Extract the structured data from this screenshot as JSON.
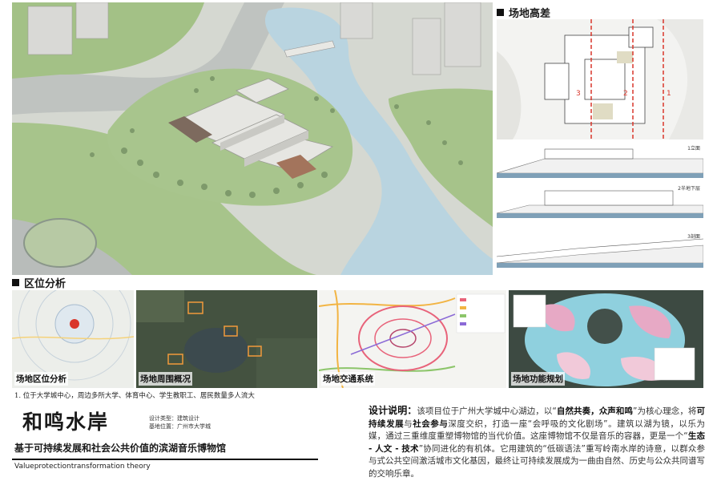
{
  "sections": {
    "elevation_title": "场地高差",
    "location_title": "区位分析"
  },
  "site_plan": {
    "line_labels": [
      "3",
      "2",
      "1"
    ]
  },
  "section_tags": [
    "1立面",
    "2半地下层",
    "3剖面"
  ],
  "panels": [
    {
      "label": "场地区位分析"
    },
    {
      "label": "场地周围概况"
    },
    {
      "label": "场地交通系统"
    },
    {
      "label": "场地功能规划"
    }
  ],
  "caption": "1. 位于大学城中心，周边多所大学、体育中心、学生教职工、居民数量多人流大",
  "project": {
    "title": "和鸣水岸",
    "design_type": "设计类型：建筑设计",
    "location": "基地位置：广州市大学城",
    "subtitle": "基于可持续发展和社会公共价值的滨湖音乐博物馆",
    "english_subtitle": "Valueprotectiontransformation theory"
  },
  "description": {
    "heading": "设计说明：",
    "p1": "该项目位于广州大学城中心湖边，以“",
    "k1": "自然共奏，众声和鸣",
    "p2": "”为核心理念，将",
    "k2": "可持续发展",
    "p3": "与",
    "k3": "社会参与",
    "p4": "深度交织，打造一座“会呼吸的文化剧场”。建筑以湖为镜，以乐为媒，通过三重维度重塑博物馆的当代价值。这座博物馆不仅是音乐的容器，更是一个“",
    "k4": "生态 - 人文 - 技术",
    "p5": "”协同进化的有机体。它用建筑的“低碳语法”重写岭南水岸的诗意，以群众参与式公共空间激活城市文化基因，最终让可持续发展成为一曲由自然、历史与公众共同谱写的交响乐章。"
  },
  "colors": {
    "accent_red": "#d9362b",
    "lawn": "#a9c58c",
    "water": "#b9d4e0"
  }
}
